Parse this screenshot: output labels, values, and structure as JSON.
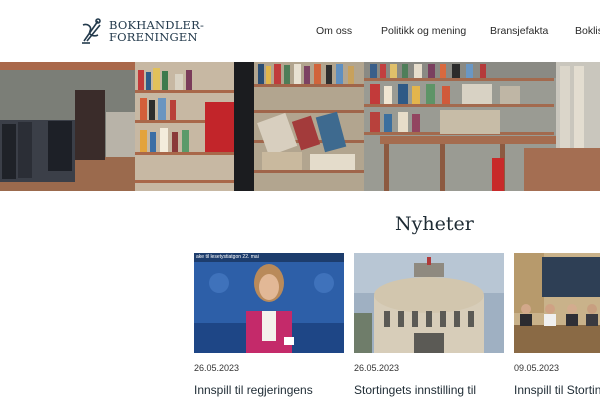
{
  "header": {
    "logo_line1": "BOKHANDLER-",
    "logo_line2": "FORENINGEN",
    "nav": [
      {
        "label": "Om oss"
      },
      {
        "label": "Politikk og mening"
      },
      {
        "label": "Bransjefakta"
      },
      {
        "label": "Boklis"
      }
    ]
  },
  "news": {
    "title": "Nyheter",
    "cards": [
      {
        "date": "26.05.2023",
        "headline": "Innspill til regjeringens",
        "thumb_caption": "ake til lesetystiatgon 22. mai",
        "thumb_icon": "speaker-photo"
      },
      {
        "date": "26.05.2023",
        "headline": "Stortingets innstilling til",
        "thumb_icon": "parliament-building-photo"
      },
      {
        "date": "09.05.2023",
        "headline": "Innspill til Storting",
        "thumb_icon": "committee-meeting-photo"
      }
    ]
  },
  "colors": {
    "accent": "#233a4c",
    "hero_wall": "#8c8f86",
    "shelf": "#a0654a"
  }
}
